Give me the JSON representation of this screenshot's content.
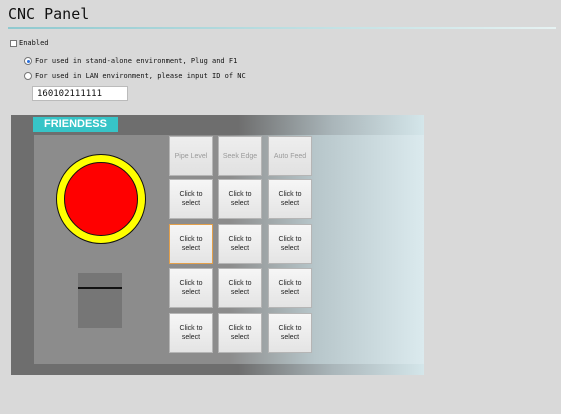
{
  "title": "CNC Panel",
  "enabled_label": "Enabled",
  "radio_standalone": "For used in stand-alone environment, Plug and F1",
  "radio_lan": "For used in LAN environment, please input ID of NC",
  "nc_id": "160102111111",
  "brand": "FRIENDESS",
  "headers": [
    "Pipe Level",
    "Seek Edge",
    "Auto Feed"
  ],
  "cell_label": "Click to select",
  "colors": {
    "estop": "#ff0000",
    "estop_ring": "#ffff00",
    "brand": "#37c4c7"
  }
}
